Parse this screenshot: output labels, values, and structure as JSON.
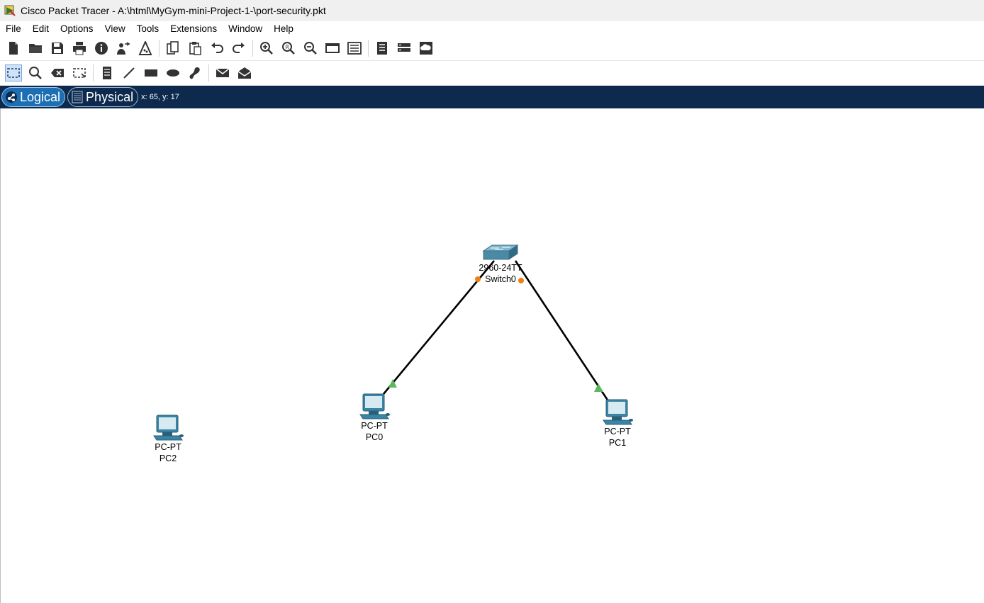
{
  "window": {
    "title": "Cisco Packet Tracer - A:\\html\\MyGym-mini-Project-1-\\port-security.pkt"
  },
  "menu": [
    "File",
    "Edit",
    "Options",
    "View",
    "Tools",
    "Extensions",
    "Window",
    "Help"
  ],
  "toolbar_main": [
    "new-file-icon",
    "open-folder-icon",
    "save-icon",
    "print-icon",
    "info-icon",
    "activity-wizard-icon",
    "pdu-icon",
    "copy-icon",
    "paste-icon",
    "undo-icon",
    "redo-icon",
    "zoom-in-icon",
    "zoom-reset-icon",
    "zoom-out-icon",
    "drawing-palette-icon",
    "custom-device-dialog-icon",
    "notes-icon",
    "device-rack-icon",
    "cloud-view-icon"
  ],
  "toolbar_tools": [
    "select-icon",
    "inspect-icon",
    "delete-icon",
    "resize-shape-icon",
    "place-note-icon",
    "draw-line-icon",
    "draw-rectangle-icon",
    "draw-ellipse-icon",
    "freeform-icon",
    "add-simple-pdu-icon",
    "add-complex-pdu-icon"
  ],
  "viewbar": {
    "logical_label": "Logical",
    "physical_label": "Physical",
    "coords": "x: 65, y: 17"
  },
  "colors": {
    "viewbar_bg": "#0d2a4e",
    "logical_active": "#1d6fb4",
    "link_up": "#5cb85c",
    "port_amber": "#f07f12"
  },
  "topology": {
    "devices": [
      {
        "id": "switch0",
        "type": "switch",
        "model": "2960-24TT",
        "name": "Switch0"
      },
      {
        "id": "pc0",
        "type": "pc",
        "model": "PC-PT",
        "name": "PC0"
      },
      {
        "id": "pc1",
        "type": "pc",
        "model": "PC-PT",
        "name": "PC1"
      },
      {
        "id": "pc2",
        "type": "pc",
        "model": "PC-PT",
        "name": "PC2"
      }
    ],
    "links": [
      {
        "from": "switch0",
        "to": "pc0",
        "switch_end": "amber",
        "pc_end": "green"
      },
      {
        "from": "switch0",
        "to": "pc1",
        "switch_end": "amber",
        "pc_end": "green"
      }
    ]
  }
}
